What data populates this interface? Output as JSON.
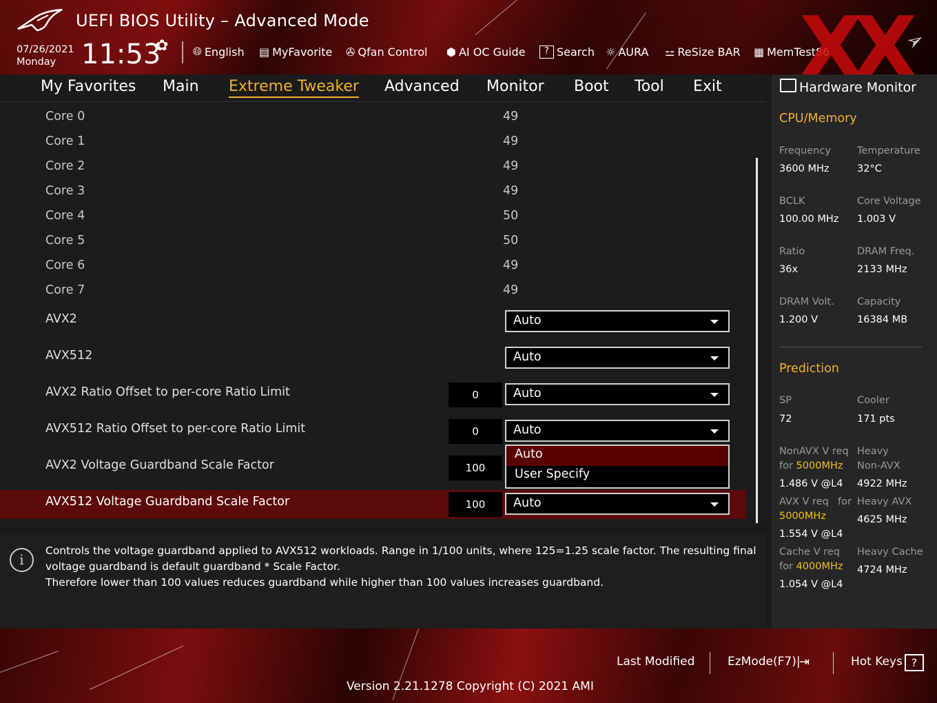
{
  "header": {
    "title": "UEFI BIOS Utility – Advanced Mode",
    "date": "07/26/2021",
    "day": "Monday",
    "time": "11:53",
    "brand_colors": {
      "accent": "#f0b030",
      "red": "#8e1010"
    }
  },
  "toolbar": [
    {
      "icon": "globe-icon",
      "label": "English"
    },
    {
      "icon": "myfavorite-icon",
      "label": "MyFavorite"
    },
    {
      "icon": "fan-icon",
      "label": "Qfan Control"
    },
    {
      "icon": "ai-chip-icon",
      "label": "AI OC Guide"
    },
    {
      "icon": "search-icon",
      "label": "Search"
    },
    {
      "icon": "aura-icon",
      "label": "AURA"
    },
    {
      "icon": "resize-bar-icon",
      "label": "ReSize BAR"
    },
    {
      "icon": "memtest-icon",
      "label": "MemTest86"
    }
  ],
  "nav": {
    "tabs": [
      "My Favorites",
      "Main",
      "Extreme Tweaker",
      "Advanced",
      "Monitor",
      "Boot",
      "Tool",
      "Exit"
    ],
    "active": "Extreme Tweaker"
  },
  "cores": [
    {
      "label": "Core 0",
      "value": "49"
    },
    {
      "label": "Core 1",
      "value": "49"
    },
    {
      "label": "Core 2",
      "value": "49"
    },
    {
      "label": "Core 3",
      "value": "49"
    },
    {
      "label": "Core 4",
      "value": "50"
    },
    {
      "label": "Core 5",
      "value": "50"
    },
    {
      "label": "Core 6",
      "value": "49"
    },
    {
      "label": "Core 7",
      "value": "49"
    }
  ],
  "settings": [
    {
      "label": "AVX2",
      "number": null,
      "value": "Auto"
    },
    {
      "label": "AVX512",
      "number": null,
      "value": "Auto"
    },
    {
      "label": "AVX2 Ratio Offset to per-core Ratio Limit",
      "number": "0",
      "value": "Auto"
    },
    {
      "label": "AVX512 Ratio Offset to per-core Ratio Limit",
      "number": "0",
      "value": "Auto"
    },
    {
      "label": "AVX2 Voltage Guardband Scale Factor",
      "number": "100",
      "value": null
    },
    {
      "label": "AVX512 Voltage Guardband Scale Factor",
      "number": "100",
      "value": "Auto"
    }
  ],
  "dropdown": {
    "options": [
      "Auto",
      "User Specify"
    ],
    "selected": "Auto"
  },
  "help": {
    "lines": [
      "Controls the voltage guardband applied to AVX512 workloads. Range in 1/100 units, where 125=1.25 scale factor. The resulting final",
      "voltage guardband is default guardband * Scale Factor.",
      "Therefore lower than 100 values reduces guardband while higher than 100 values increases guardband."
    ]
  },
  "hardware_monitor": {
    "title": "Hardware Monitor",
    "cpu_memory": {
      "heading": "CPU/Memory",
      "frequency_label": "Frequency",
      "frequency": "3600 MHz",
      "temperature_label": "Temperature",
      "temperature": "32°C",
      "bclk_label": "BCLK",
      "bclk": "100.00 MHz",
      "core_voltage_label": "Core Voltage",
      "core_voltage": "1.003 V",
      "ratio_label": "Ratio",
      "ratio": "36x",
      "dram_freq_label": "DRAM Freq.",
      "dram_freq": "2133 MHz",
      "dram_volt_label": "DRAM Volt.",
      "dram_volt": "1.200 V",
      "capacity_label": "Capacity",
      "capacity": "16384 MB"
    },
    "prediction": {
      "heading": "Prediction",
      "sp_label": "SP",
      "sp": "72",
      "cooler_label": "Cooler",
      "cooler": "171 pts",
      "nonavx_label1": "NonAVX V req",
      "nonavx_label2_prefix": "for ",
      "nonavx_freq": "5000MHz",
      "nonavx_v": "1.486 V @L4",
      "heavy_nonavx_label1": "Heavy",
      "heavy_nonavx_label2": "Non-AVX",
      "heavy_nonavx": "4922 MHz",
      "avx_label1": "AVX V req",
      "avx_label_for": "for",
      "avx_freq": "5000MHz",
      "avx_v": "1.554 V @L4",
      "heavy_avx_label": "Heavy AVX",
      "heavy_avx": "4625 MHz",
      "cache_label1": "Cache V req",
      "cache_label2_prefix": "for ",
      "cache_freq": "4000MHz",
      "cache_v": "1.054 V @L4",
      "heavy_cache_label": "Heavy Cache",
      "heavy_cache": "4724 MHz"
    }
  },
  "footer": {
    "last_modified": "Last Modified",
    "ezmode": "EzMode(F7)|",
    "hot_keys": "Hot Keys",
    "hot_keys_symbol": "?",
    "version": "Version 2.21.1278 Copyright (C) 2021 AMI"
  }
}
